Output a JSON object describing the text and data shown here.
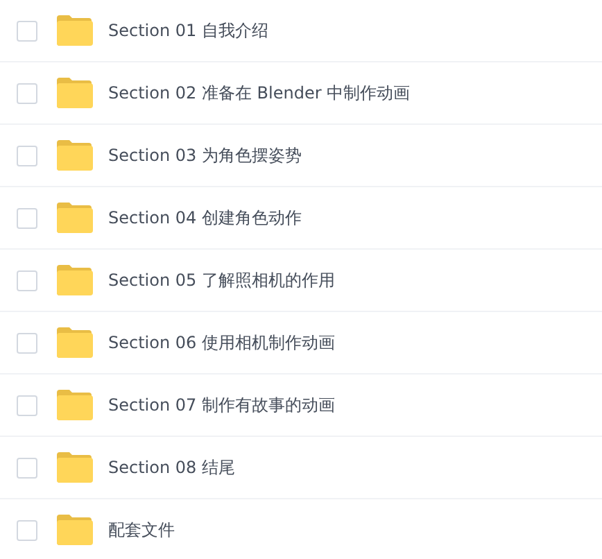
{
  "files": [
    {
      "name": "Section 01 自我介绍",
      "checked": false
    },
    {
      "name": "Section 02 准备在 Blender 中制作动画",
      "checked": false
    },
    {
      "name": "Section 03 为角色摆姿势",
      "checked": false
    },
    {
      "name": "Section 04 创建角色动作",
      "checked": false
    },
    {
      "name": "Section 05 了解照相机的作用",
      "checked": false
    },
    {
      "name": "Section 06 使用相机制作动画",
      "checked": false
    },
    {
      "name": "Section 07 制作有故事的动画",
      "checked": false
    },
    {
      "name": "Section 08 结尾",
      "checked": false
    },
    {
      "name": "配套文件",
      "checked": false
    }
  ]
}
